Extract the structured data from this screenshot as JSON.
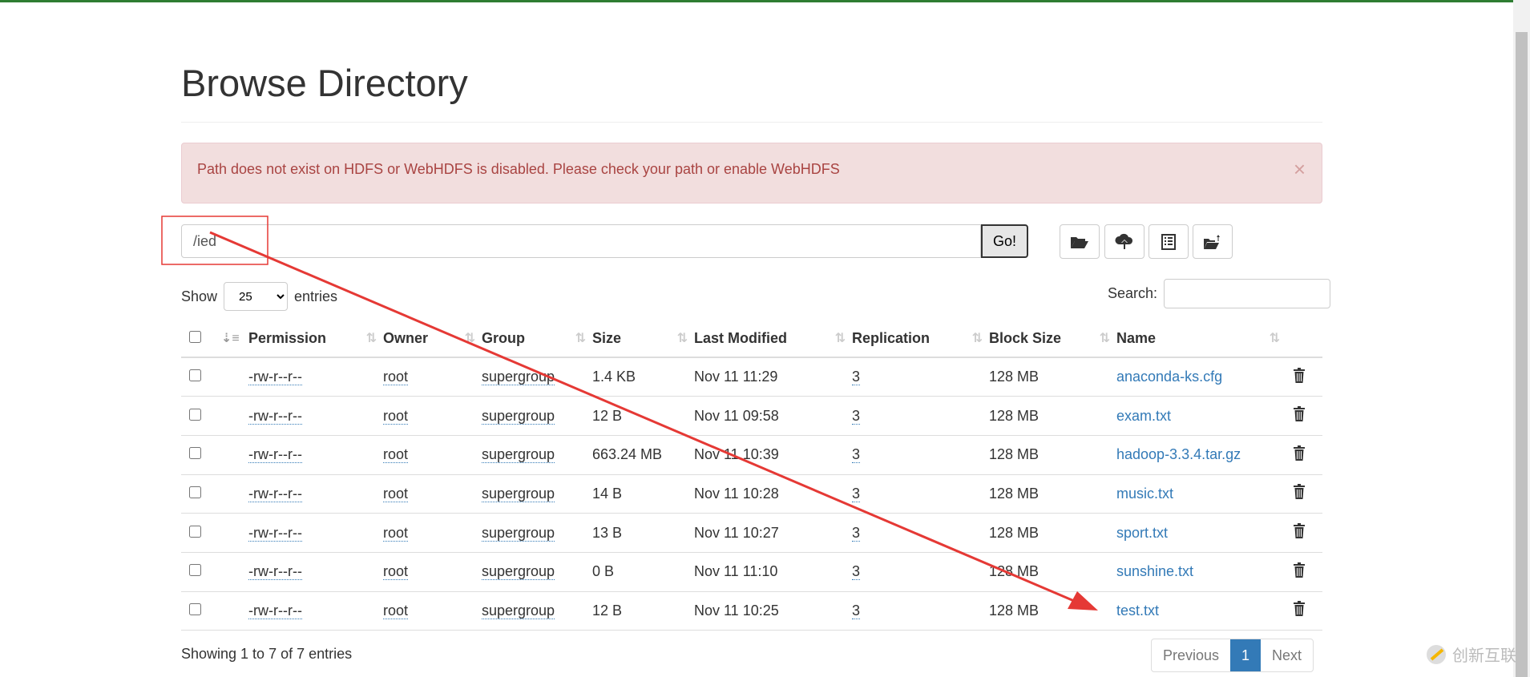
{
  "title": "Browse Directory",
  "alert": {
    "message": "Path does not exist on HDFS or WebHDFS is disabled. Please check your path or enable WebHDFS",
    "close": "×"
  },
  "path": {
    "value": "/ied"
  },
  "go_label": "Go!",
  "toolbar_icons": [
    "folder-open-icon",
    "cloud-upload-icon",
    "list-icon",
    "folder-upload-icon"
  ],
  "show": {
    "label_before": "Show",
    "value": "25",
    "label_after": "entries"
  },
  "search": {
    "label": "Search:",
    "value": ""
  },
  "columns": [
    "Permission",
    "Owner",
    "Group",
    "Size",
    "Last Modified",
    "Replication",
    "Block Size",
    "Name"
  ],
  "rows": [
    {
      "permission": "-rw-r--r--",
      "owner": "root",
      "group": "supergroup",
      "size": "1.4 KB",
      "modified": "Nov 11 11:29",
      "replication": "3",
      "block": "128 MB",
      "name": "anaconda-ks.cfg"
    },
    {
      "permission": "-rw-r--r--",
      "owner": "root",
      "group": "supergroup",
      "size": "12 B",
      "modified": "Nov 11 09:58",
      "replication": "3",
      "block": "128 MB",
      "name": "exam.txt"
    },
    {
      "permission": "-rw-r--r--",
      "owner": "root",
      "group": "supergroup",
      "size": "663.24 MB",
      "modified": "Nov 11 10:39",
      "replication": "3",
      "block": "128 MB",
      "name": "hadoop-3.3.4.tar.gz"
    },
    {
      "permission": "-rw-r--r--",
      "owner": "root",
      "group": "supergroup",
      "size": "14 B",
      "modified": "Nov 11 10:28",
      "replication": "3",
      "block": "128 MB",
      "name": "music.txt"
    },
    {
      "permission": "-rw-r--r--",
      "owner": "root",
      "group": "supergroup",
      "size": "13 B",
      "modified": "Nov 11 10:27",
      "replication": "3",
      "block": "128 MB",
      "name": "sport.txt"
    },
    {
      "permission": "-rw-r--r--",
      "owner": "root",
      "group": "supergroup",
      "size": "0 B",
      "modified": "Nov 11 11:10",
      "replication": "3",
      "block": "128 MB",
      "name": "sunshine.txt"
    },
    {
      "permission": "-rw-r--r--",
      "owner": "root",
      "group": "supergroup",
      "size": "12 B",
      "modified": "Nov 11 10:25",
      "replication": "3",
      "block": "128 MB",
      "name": "test.txt"
    }
  ],
  "info": "Showing 1 to 7 of 7 entries",
  "pagination": {
    "previous": "Previous",
    "current": "1",
    "next": "Next"
  },
  "watermark": "创新互联",
  "colors": {
    "accent": "#337ab7",
    "alert_bg": "#f2dede",
    "alert_text": "#a94442",
    "annotation": "#e53935"
  }
}
